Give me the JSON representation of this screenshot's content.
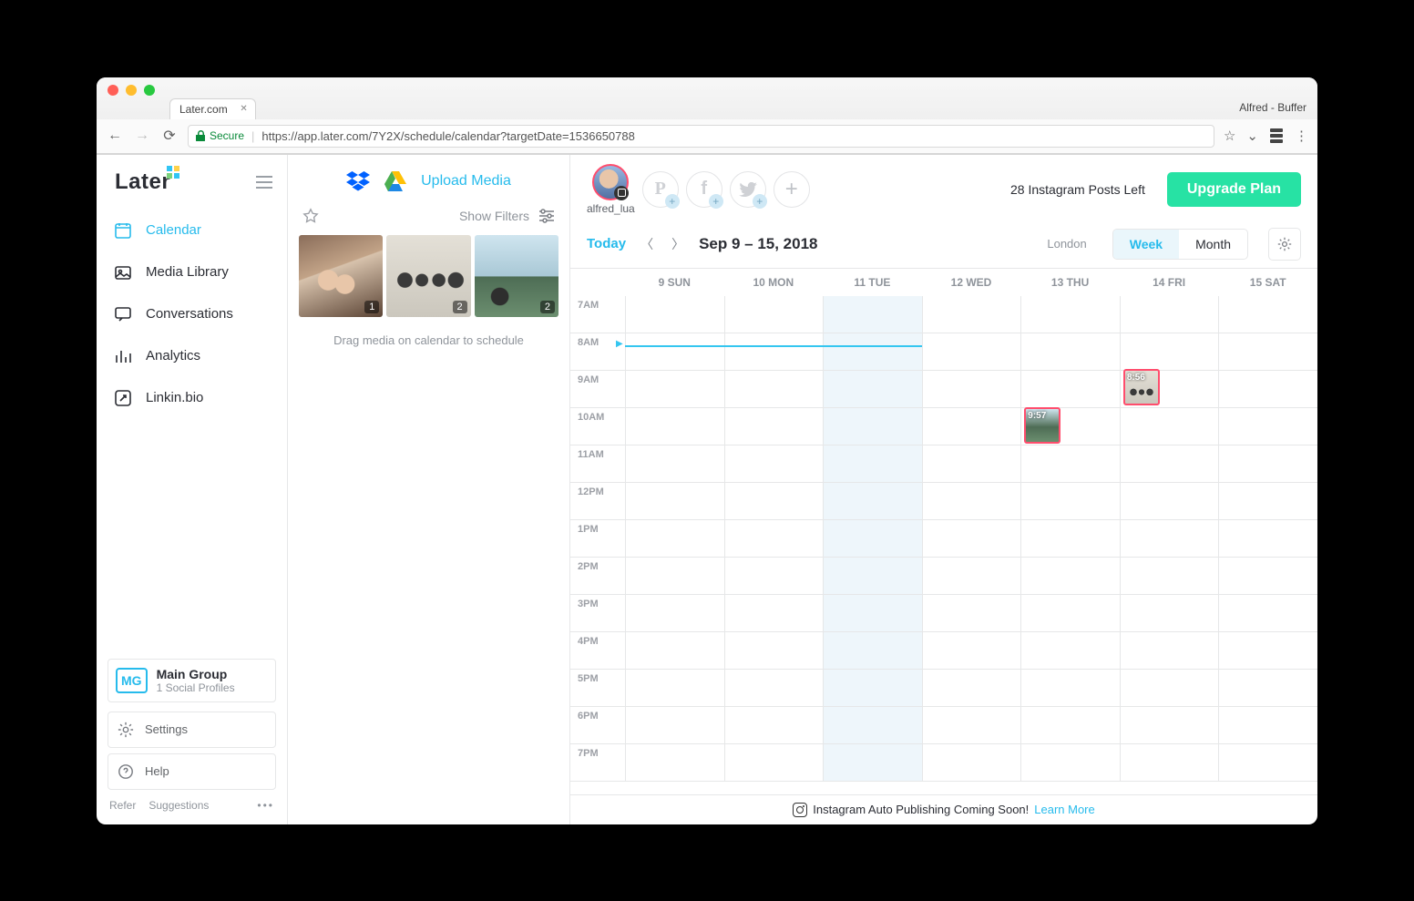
{
  "browser": {
    "tab_title": "Later.com",
    "user_label": "Alfred - Buffer",
    "secure_label": "Secure",
    "url": "https://app.later.com/7Y2X/schedule/calendar?targetDate=1536650788"
  },
  "logo_text": "Later",
  "nav": [
    {
      "id": "calendar",
      "label": "Calendar",
      "active": true
    },
    {
      "id": "media",
      "label": "Media Library",
      "active": false
    },
    {
      "id": "convo",
      "label": "Conversations",
      "active": false
    },
    {
      "id": "analytics",
      "label": "Analytics",
      "active": false
    },
    {
      "id": "linkin",
      "label": "Linkin.bio",
      "active": false
    }
  ],
  "group": {
    "badge": "MG",
    "name": "Main Group",
    "profiles": "1 Social Profiles"
  },
  "util": {
    "settings": "Settings",
    "help": "Help",
    "refer": "Refer",
    "suggestions": "Suggestions"
  },
  "media": {
    "upload": "Upload Media",
    "show_filters": "Show Filters",
    "thumbs": [
      {
        "count": "1"
      },
      {
        "count": "2"
      },
      {
        "count": "2"
      }
    ],
    "hint": "Drag media on calendar to schedule"
  },
  "header": {
    "username": "alfred_lua",
    "posts_left": "28 Instagram Posts Left",
    "upgrade": "Upgrade Plan"
  },
  "toolbar": {
    "today": "Today",
    "range": "Sep 9 – 15, 2018",
    "timezone": "London",
    "week": "Week",
    "month": "Month"
  },
  "days": [
    "9 SUN",
    "10 MON",
    "11 TUE",
    "12 WED",
    "13 THU",
    "14 FRI",
    "15 SAT"
  ],
  "hours": [
    "7AM",
    "8AM",
    "9AM",
    "10AM",
    "11AM",
    "12PM",
    "1PM",
    "2PM",
    "3PM",
    "4PM",
    "5PM",
    "6PM",
    "7PM"
  ],
  "events": [
    {
      "time": "9:57"
    },
    {
      "time": "8:56"
    }
  ],
  "banner": {
    "text": "Instagram Auto Publishing Coming Soon!",
    "link": "Learn More"
  }
}
